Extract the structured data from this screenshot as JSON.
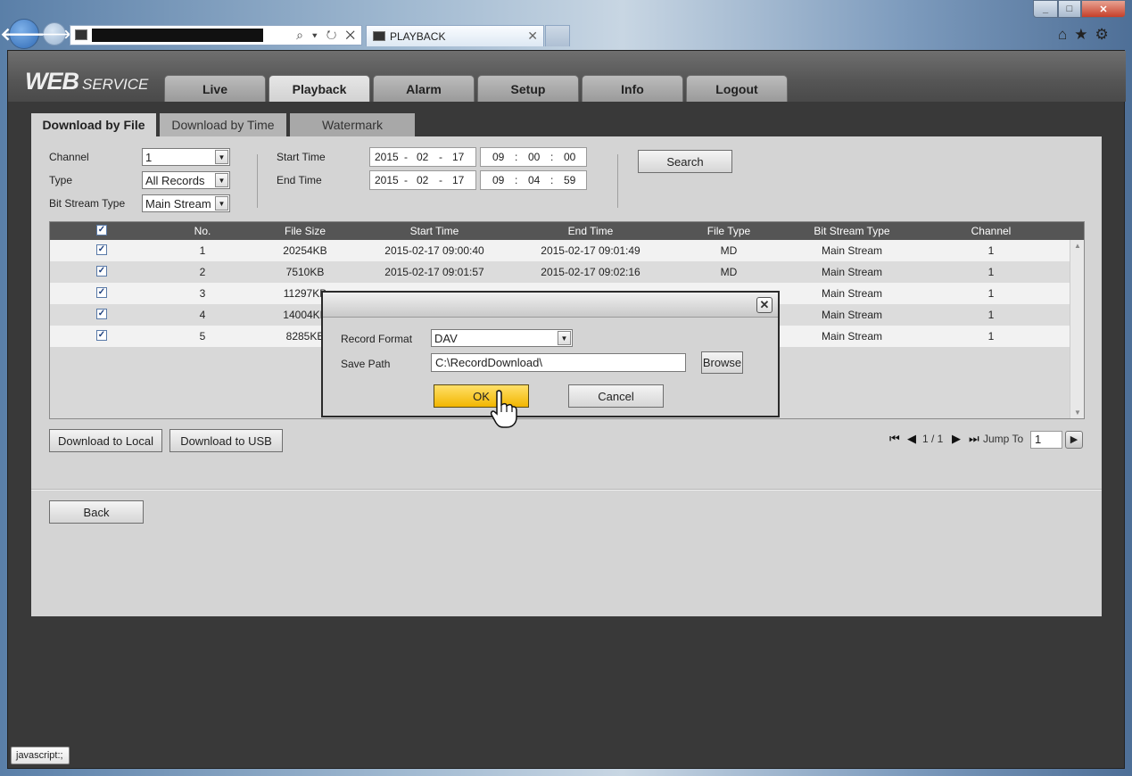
{
  "browser": {
    "tab_title": "PLAYBACK",
    "search_tools": "⌕ ▾ ↻ ✕",
    "right_tools": "⌂★⚙",
    "window_min": "_",
    "window_max": "□",
    "window_close": "✕",
    "status_text": "javascript:;"
  },
  "logo": {
    "web": "WEB",
    "service": "SERVICE"
  },
  "nav": [
    "Live",
    "Playback",
    "Alarm",
    "Setup",
    "Info",
    "Logout"
  ],
  "subtabs": [
    "Download by File",
    "Download by Time",
    "Watermark"
  ],
  "filters": {
    "channel_label": "Channel",
    "channel_value": "1",
    "type_label": "Type",
    "type_value": "All Records",
    "bitstream_label": "Bit Stream Type",
    "bitstream_value": "Main Stream",
    "start_label": "Start Time",
    "start_date": [
      "2015",
      "02",
      "17"
    ],
    "start_time": [
      "09",
      "00",
      "00"
    ],
    "end_label": "End Time",
    "end_date": [
      "2015",
      "02",
      "17"
    ],
    "end_time": [
      "09",
      "04",
      "59"
    ],
    "search_button": "Search"
  },
  "table": {
    "headers": [
      "No.",
      "File Size",
      "Start Time",
      "End Time",
      "File Type",
      "Bit Stream Type",
      "Channel"
    ],
    "rows": [
      {
        "no": "1",
        "size": "20254KB",
        "start": "2015-02-17 09:00:40",
        "end": "2015-02-17 09:01:49",
        "ftype": "MD",
        "stream": "Main Stream",
        "ch": "1"
      },
      {
        "no": "2",
        "size": "7510KB",
        "start": "2015-02-17 09:01:57",
        "end": "2015-02-17 09:02:16",
        "ftype": "MD",
        "stream": "Main Stream",
        "ch": "1"
      },
      {
        "no": "3",
        "size": "11297KB",
        "start": "",
        "end": "",
        "ftype": "",
        "stream": "Main Stream",
        "ch": "1"
      },
      {
        "no": "4",
        "size": "14004KB",
        "start": "",
        "end": "",
        "ftype": "",
        "stream": "Main Stream",
        "ch": "1"
      },
      {
        "no": "5",
        "size": "8285KB",
        "start": "",
        "end": "",
        "ftype": "",
        "stream": "Main Stream",
        "ch": "1"
      }
    ]
  },
  "actions": {
    "download_local": "Download to Local",
    "download_usb": "Download to USB",
    "back": "Back"
  },
  "pager": {
    "page": "1 / 1",
    "jump_label": "Jump To",
    "jump_value": "1"
  },
  "dialog": {
    "format_label": "Record Format",
    "format_value": "DAV",
    "path_label": "Save Path",
    "path_value": "C:\\RecordDownload\\",
    "browse": "Browse",
    "ok": "OK",
    "cancel": "Cancel"
  }
}
